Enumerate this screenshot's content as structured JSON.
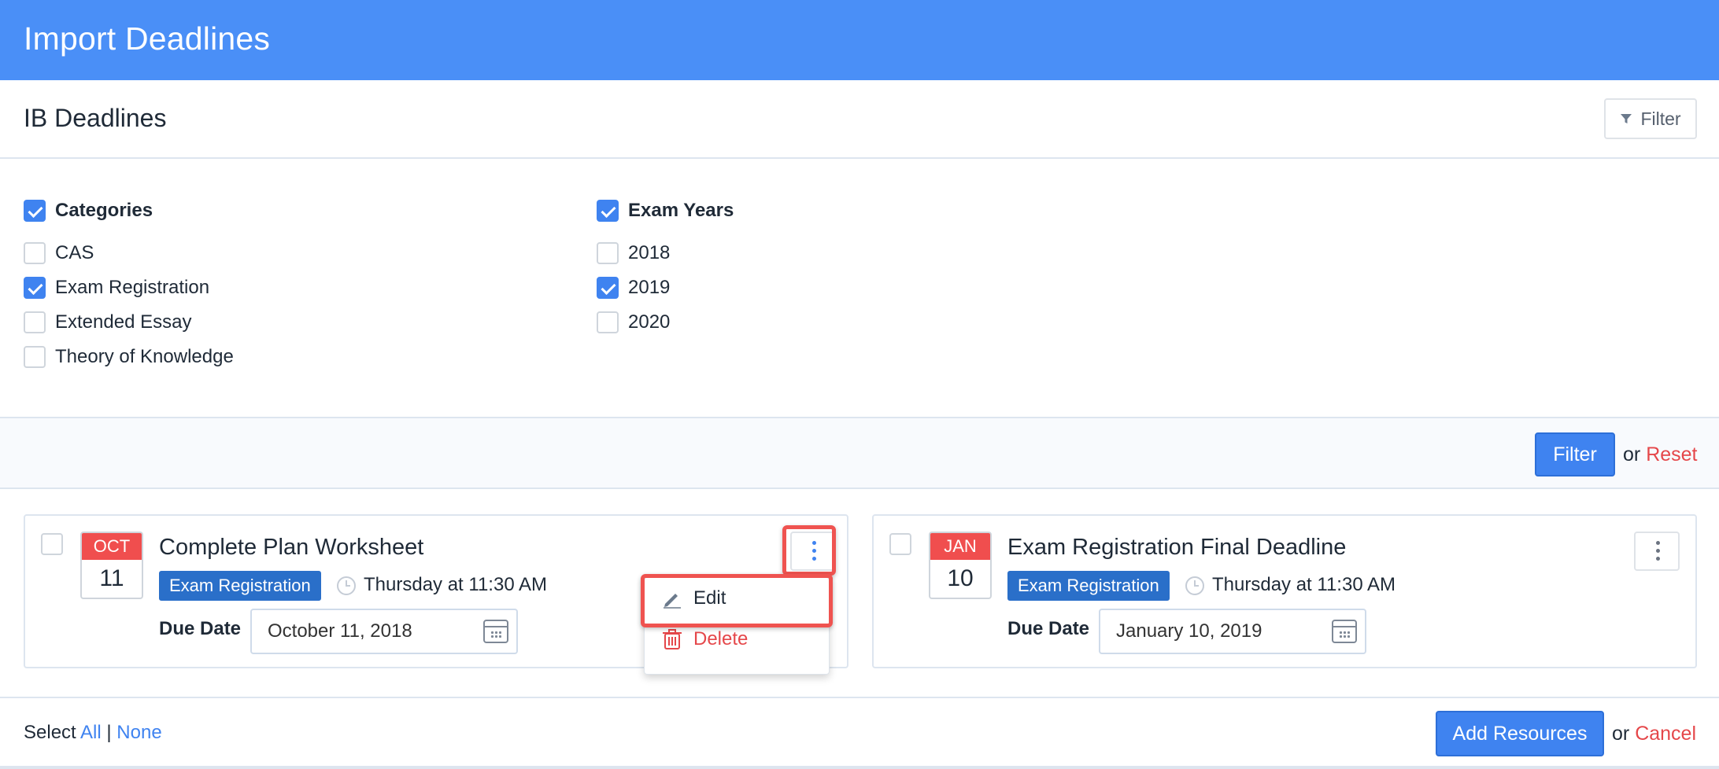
{
  "app": {
    "title": "Import Deadlines"
  },
  "header": {
    "section_title": "IB Deadlines",
    "filter_button_label": "Filter"
  },
  "filters": {
    "categories": {
      "label": "Categories",
      "checked": true,
      "options": [
        {
          "label": "CAS",
          "checked": false
        },
        {
          "label": "Exam Registration",
          "checked": true
        },
        {
          "label": "Extended Essay",
          "checked": false
        },
        {
          "label": "Theory of Knowledge",
          "checked": false
        }
      ]
    },
    "exam_years": {
      "label": "Exam Years",
      "checked": true,
      "options": [
        {
          "label": "2018",
          "checked": false
        },
        {
          "label": "2019",
          "checked": true
        },
        {
          "label": "2020",
          "checked": false
        }
      ]
    }
  },
  "action_bar": {
    "filter_label": "Filter",
    "or_text": "or",
    "reset_label": "Reset"
  },
  "deadlines": [
    {
      "month": "OCT",
      "day": "11",
      "title": "Complete Plan Worksheet",
      "category": "Exam Registration",
      "time": "Thursday at 11:30 AM",
      "due_label": "Due Date",
      "due_value": "October 11, 2018",
      "checked": false
    },
    {
      "month": "JAN",
      "day": "10",
      "title": "Exam Registration Final Deadline",
      "category": "Exam Registration",
      "time": "Thursday at 11:30 AM",
      "due_label": "Due Date",
      "due_value": "January 10, 2019",
      "checked": false
    }
  ],
  "context_menu": {
    "edit_label": "Edit",
    "delete_label": "Delete"
  },
  "footer": {
    "select_text": "Select",
    "all_label": "All",
    "separator": "|",
    "none_label": "None",
    "add_label": "Add Resources",
    "or_text": "or",
    "cancel_label": "Cancel"
  },
  "colors": {
    "header_bg": "#4a8ff7",
    "primary": "#3f83f0",
    "danger": "#e5474a",
    "badge": "#2a6fc9",
    "calendar_month": "#f04e4e",
    "highlight": "#ef5350"
  },
  "icons": {
    "filter": "funnel-icon",
    "clock": "clock-icon",
    "calendar": "calendar-icon",
    "menu": "kebab-icon",
    "edit": "pencil-icon",
    "delete": "trash-icon"
  }
}
